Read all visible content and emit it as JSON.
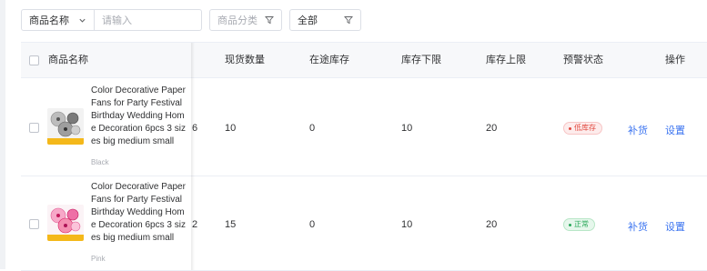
{
  "filters": {
    "field_select": "商品名称",
    "search_placeholder": "请输入",
    "category_placeholder": "商品分类",
    "status_select": "全部"
  },
  "columns": {
    "name": "商品名称",
    "stock": "现货数量",
    "in_transit": "在途库存",
    "min": "库存下限",
    "max": "库存上限",
    "status": "预警状态",
    "actions": "操作"
  },
  "rows": [
    {
      "name": "Color Decorative Paper Fans for Party Festival Birthday Wedding Home Decoration 6pcs 3 sizes big medium small",
      "variant": "Black",
      "cut_value": "6",
      "stock": "10",
      "in_transit": "0",
      "min": "10",
      "max": "20",
      "status": "低库存",
      "restock": "补货",
      "settings": "设置"
    },
    {
      "name": "Color Decorative Paper Fans for Party Festival Birthday Wedding Home Decoration 6pcs 3 sizes big medium small",
      "variant": "Pink",
      "cut_value": "2",
      "stock": "15",
      "in_transit": "0",
      "min": "10",
      "max": "20",
      "status": "正常",
      "restock": "补货",
      "settings": "设置"
    }
  ],
  "colors": {
    "accent": "#3a73f0",
    "low_stock": "#e2493f",
    "normal": "#2aa85a"
  }
}
